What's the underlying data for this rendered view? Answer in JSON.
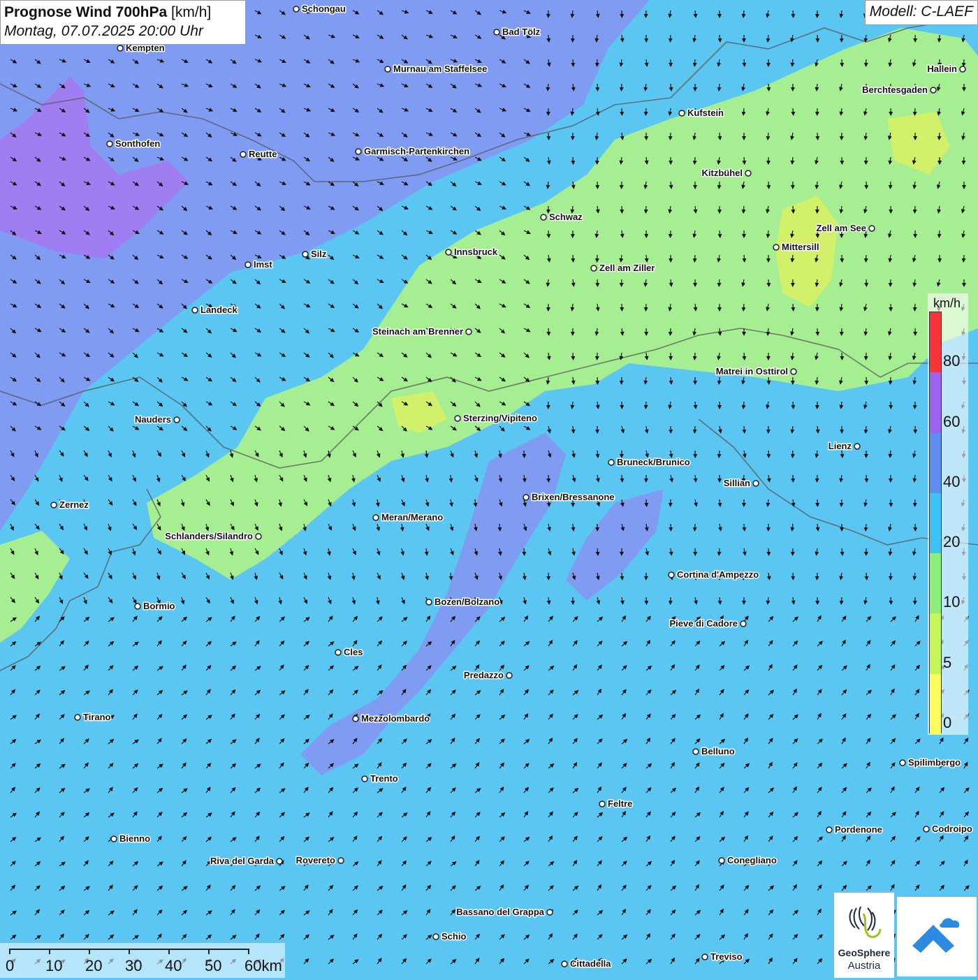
{
  "header": {
    "title_main": "Prognose Wind 700hPa",
    "title_unit": " [km/h]",
    "subtitle": "Montag, 07.07.2025 20:00 Uhr"
  },
  "model": "Modell: C-LAEF",
  "legend": {
    "unit": "km/h",
    "levels": [
      {
        "label": "0",
        "color": "#fdfc5c"
      },
      {
        "label": "5",
        "color": "#c5f558"
      },
      {
        "label": "10",
        "color": "#8eee7a"
      },
      {
        "label": "20",
        "color": "#3cc3f2"
      },
      {
        "label": "40",
        "color": "#5e8ef2"
      },
      {
        "label": "60",
        "color": "#9a63f0"
      },
      {
        "label": "80",
        "color": "#f5353a"
      }
    ]
  },
  "scalebar": {
    "labels": [
      "0",
      "10",
      "20",
      "30",
      "40",
      "50",
      "60km"
    ]
  },
  "logos": {
    "geosphere_name": "GeoSphere",
    "geosphere_sub": "Austria"
  },
  "icons": {
    "geosphere": "geosphere-logo-icon",
    "app": "wetter-app-logo-icon"
  },
  "cities": [
    {
      "name": "Schongau"
    },
    {
      "name": "Bad Tölz"
    },
    {
      "name": "Kempten"
    },
    {
      "name": "Murnau am Staffelsee"
    },
    {
      "name": "Hallein"
    },
    {
      "name": "Berchtesgaden"
    },
    {
      "name": "Kufstein"
    },
    {
      "name": "Sonthofen"
    },
    {
      "name": "Reutte"
    },
    {
      "name": "Garmisch-Partenkirchen"
    },
    {
      "name": "Kitzbühel"
    },
    {
      "name": "Schwaz"
    },
    {
      "name": "Zell am See"
    },
    {
      "name": "Mittersill"
    },
    {
      "name": "Innsbruck"
    },
    {
      "name": "Silz"
    },
    {
      "name": "Imst"
    },
    {
      "name": "Zell am Ziller"
    },
    {
      "name": "Landeck"
    },
    {
      "name": "Steinach am Brenner"
    },
    {
      "name": "Matrei in Osttirol"
    },
    {
      "name": "Nauders"
    },
    {
      "name": "Sterzing/Vipiteno"
    },
    {
      "name": "Lienz"
    },
    {
      "name": "Bruneck/Brunico"
    },
    {
      "name": "Sillian"
    },
    {
      "name": "Zernez"
    },
    {
      "name": "Brixen/Bressanone"
    },
    {
      "name": "Meran/Merano"
    },
    {
      "name": "Schlanders/Silandro"
    },
    {
      "name": "Cortina d'Ampezzo"
    },
    {
      "name": "Bormio"
    },
    {
      "name": "Bozen/Bolzano"
    },
    {
      "name": "Pieve di Cadore"
    },
    {
      "name": "Cles"
    },
    {
      "name": "Predazzo"
    },
    {
      "name": "Tirano"
    },
    {
      "name": "Mezzolombardo"
    },
    {
      "name": "Belluno"
    },
    {
      "name": "Spilimbergo"
    },
    {
      "name": "Trento"
    },
    {
      "name": "Feltre"
    },
    {
      "name": "Pordenone"
    },
    {
      "name": "Codroipo"
    },
    {
      "name": "Bienno"
    },
    {
      "name": "Riva del Garda"
    },
    {
      "name": "Rovereto"
    },
    {
      "name": "Conegliano"
    },
    {
      "name": "Bassano del Grappa"
    },
    {
      "name": "Schio"
    },
    {
      "name": "Treviso"
    },
    {
      "name": "Cittadella"
    }
  ]
}
